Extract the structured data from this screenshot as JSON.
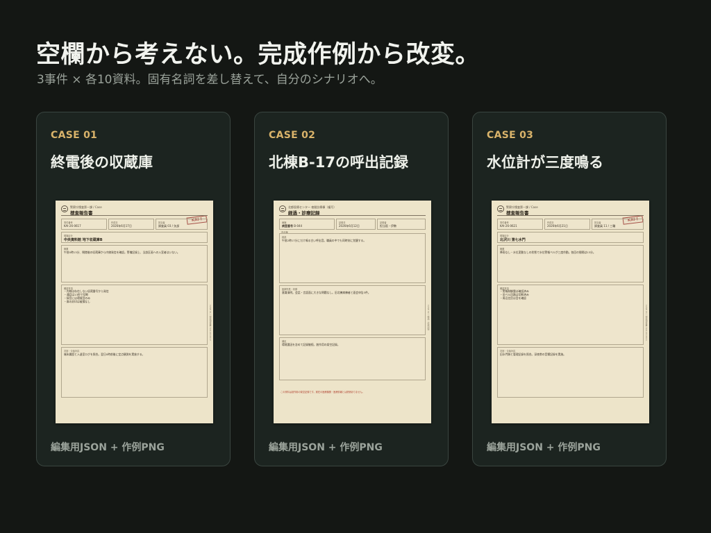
{
  "header": {
    "title": "空欄から考えない。完成作例から改変。",
    "subtitle": "3事件 × 各10資料。固有名詞を差し替えて、自分のシナリオへ。"
  },
  "colors": {
    "background": "#141714",
    "card": "#1c2420",
    "accent": "#d9b36a",
    "paper": "#ede4c9",
    "stamp": "#a34a40"
  },
  "cards": [
    {
      "case_label": "CASE 01",
      "title": "終電後の収蔵庫",
      "footer": "編集用JSON + 作例PNG",
      "doc": {
        "dept": "警察庁捜査第一課 / Case",
        "title": "捜査報告書",
        "stamp": "KAI-I",
        "fields": [
          {
            "label": "事件番号",
            "value": "KAI-26-0617"
          },
          {
            "label": "作成日",
            "value": "2026年6月17日"
          },
          {
            "label": "担当者",
            "value": "調査員 03 / 矢部"
          }
        ],
        "location_label": "現場区分",
        "location": "中央資料館 地下収蔵庫B",
        "summary_label": "概要",
        "summary": "午前0時13分、閉館後の収蔵庫から内線発信を確認。警備記録上、当該区画への入室者はいない。",
        "findings_label": "確認事項",
        "findings": [
          "・内線は存在しない収蔵番号から発信",
          "・通話は13秒で切断",
          "・録音には環境音のみ",
          "・扉の封印は破損なし"
        ],
        "next_label": "次回・今後対応",
        "next": "端末履歴と入退室ログを照合。翌日0時前後に定点観測を実施する。",
        "side": "CASE 01 / 捜査報告書 / KAI-26-0617"
      }
    },
    {
      "case_label": "CASE 02",
      "title": "北棟B-17の呼出記録",
      "footer": "編集用JSON + 作例PNG",
      "doc": {
        "dept": "北都医療センター 夜間診療棟（複写）",
        "title": "経過・診療記録",
        "fields": [
          {
            "label": "病棟",
            "value": "旧北棟"
          },
          {
            "label": "記録日",
            "value": "2026年6月12日"
          },
          {
            "label": "記録者",
            "value": "担当医・伊勢"
          }
        ],
        "room_label": "病室番号",
        "room": "B-044",
        "summary_label": "経過",
        "summary": "午前2時17分にだけ鳴る古い呼出音。職員の中でも同時刻に覚醒する。",
        "findings_label": "医師所見・判断",
        "findings": "意識清明。会話・言語面に大きな問題なし。旧北棟病棟者と面会申告3件。",
        "next_label": "補足",
        "next": "環境要因を含めて記録継続。創作用の架空記録。",
        "warn": "この資料は創作用の架空記録です。実在の医療機関・医療情報とは関係ありません。",
        "side": "CASE 02 / 経過・診療記録"
      }
    },
    {
      "case_label": "CASE 03",
      "title": "水位計が三度鳴る",
      "footer": "編集用JSON + 作例PNG",
      "doc": {
        "dept": "警察庁捜査第一課 / Case",
        "title": "捜査報告書",
        "stamp": "KAI-I",
        "fields": [
          {
            "label": "事件番号",
            "value": "KAI-26-0621"
          },
          {
            "label": "作成日",
            "value": "2026年6月21日"
          },
          {
            "label": "担当者",
            "value": "調査員 11 / 三輪"
          }
        ],
        "location_label": "現場区分",
        "location": "北沢川 第七水門",
        "summary_label": "概要",
        "summary": "降雨なし・水位変動なしの状態で水位警報ベルが三度作動。各回の間隔は13分。",
        "findings_label": "確認事項",
        "findings": [
          "・警報制御盤は確認済み",
          "・旧ベル回路は切断済み",
          "・周辺住民は音を確認"
        ],
        "next_label": "次回・今後対応",
        "next": "旧水門跡と管理記録を照合。深夜帯の音響記録を実施。",
        "side": "CASE 03 / 捜査報告書 / KAI-26-0621"
      }
    }
  ]
}
